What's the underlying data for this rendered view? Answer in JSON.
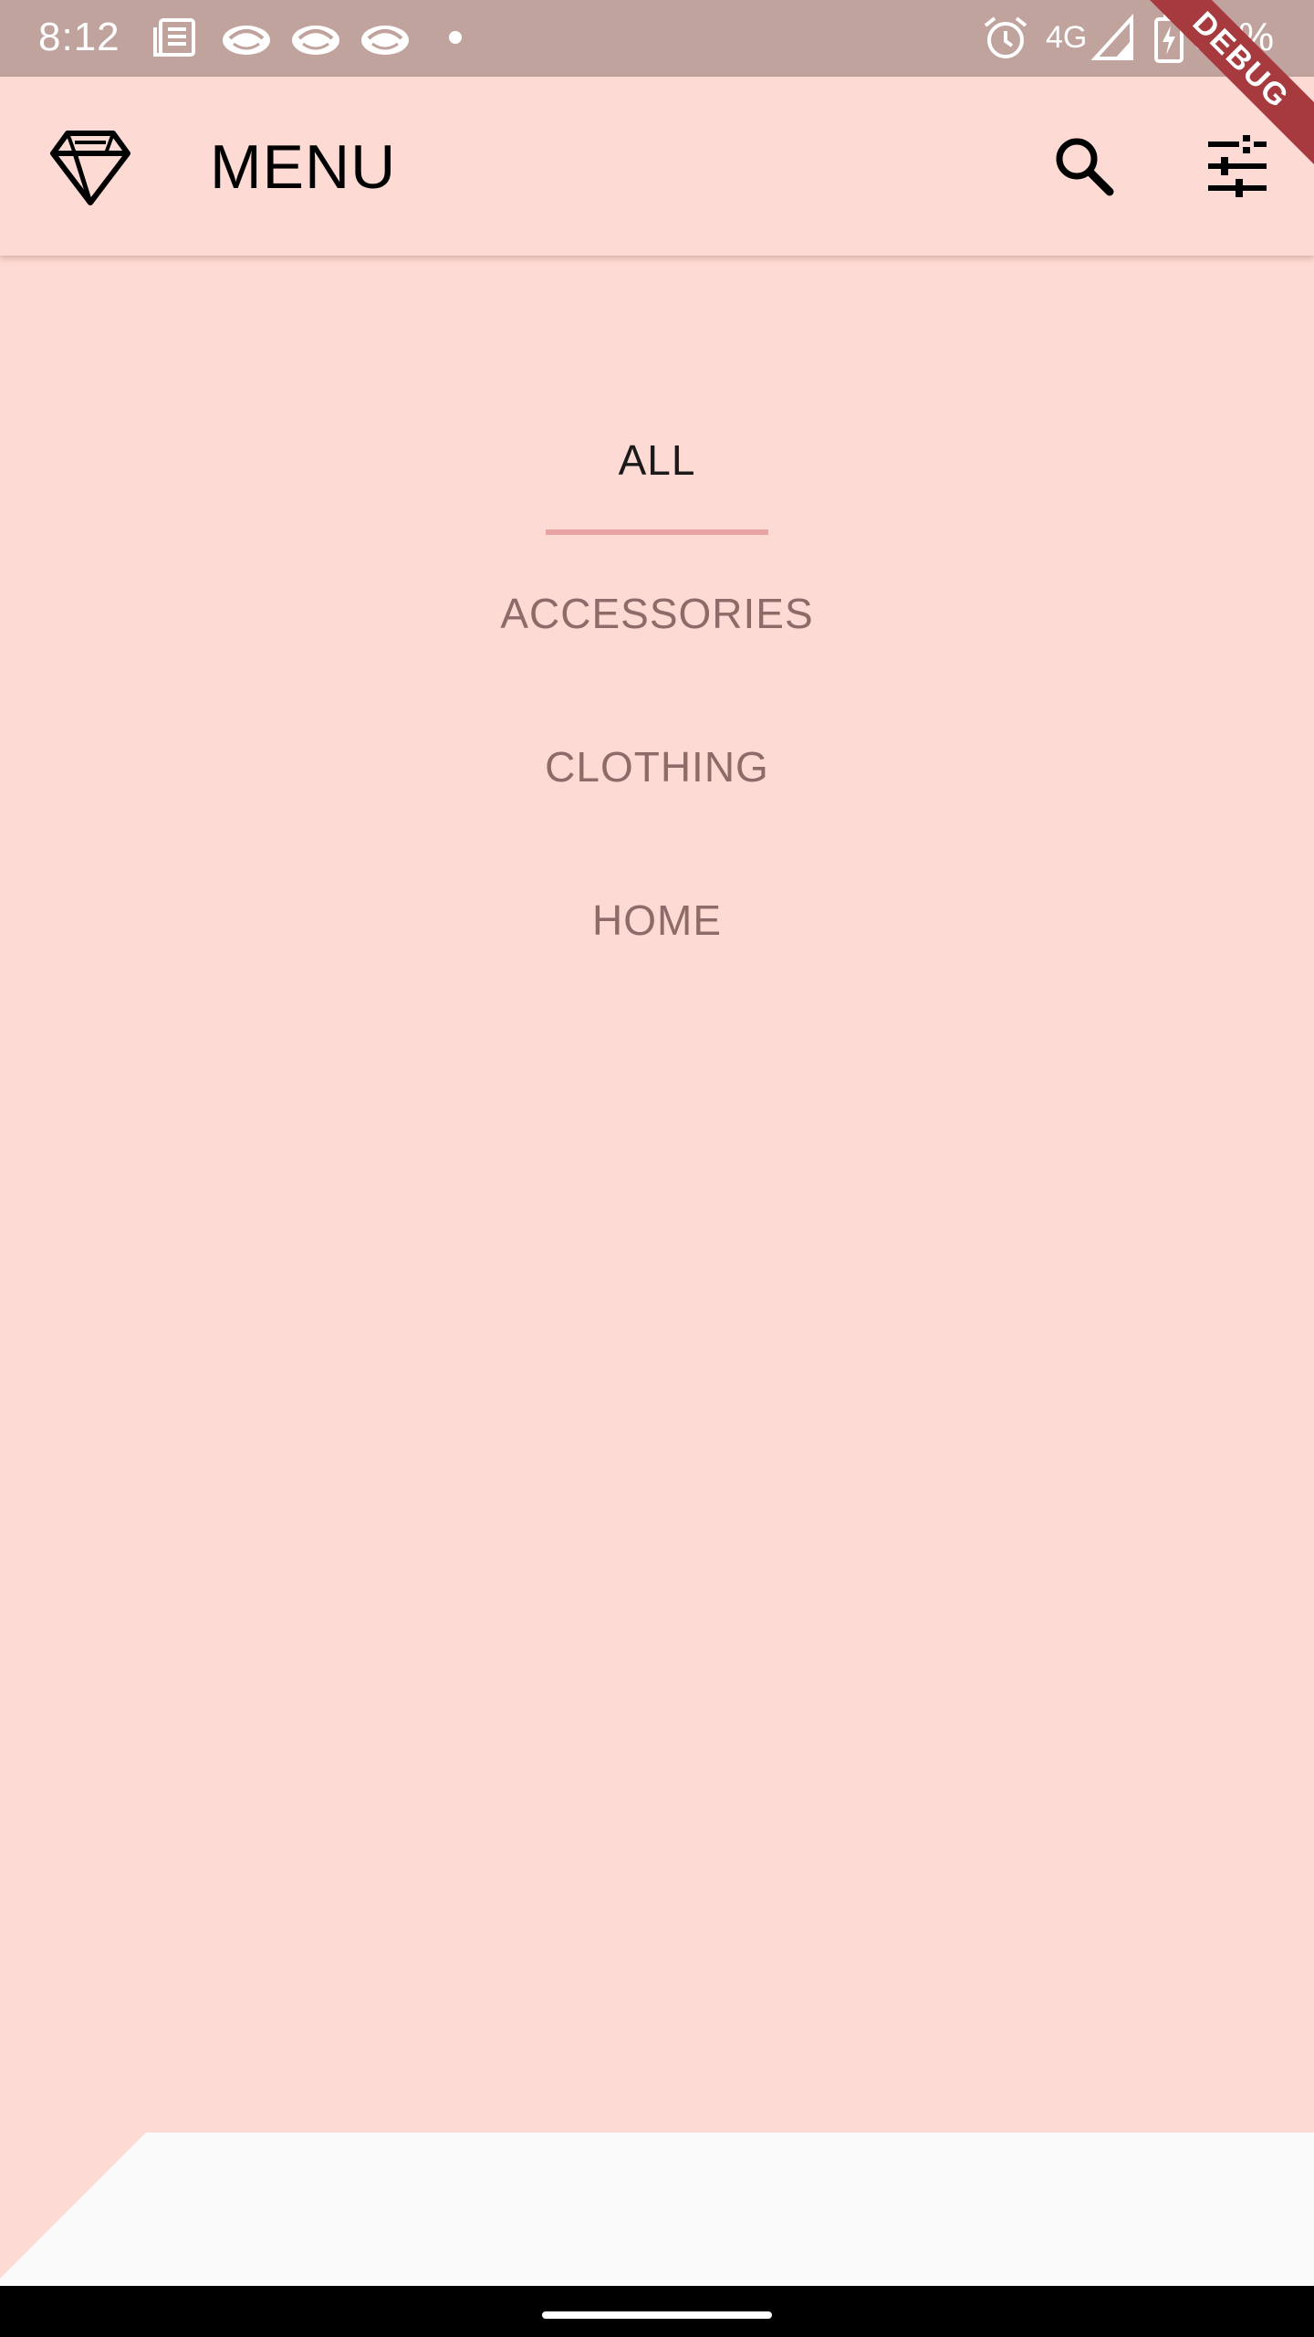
{
  "status_bar": {
    "time": "8:12",
    "network": "4G",
    "battery": "51%",
    "icons": [
      "news-icon",
      "mail-icon",
      "mail-icon",
      "mail-icon",
      "dot-icon",
      "alarm-icon",
      "signal-icon",
      "battery-charging-icon"
    ]
  },
  "debug_banner": "DEBUG",
  "app_bar": {
    "title": "MENU",
    "logo_icon": "diamond-icon",
    "actions": [
      "search-icon",
      "tune-icon"
    ]
  },
  "menu": {
    "items": [
      {
        "label": "ALL",
        "active": true
      },
      {
        "label": "ACCESSORIES",
        "active": false
      },
      {
        "label": "CLOTHING",
        "active": false
      },
      {
        "label": "HOME",
        "active": false
      }
    ]
  },
  "colors": {
    "background": "#FDDAD3",
    "status_bar": "#C1A39E",
    "inactive_text": "#8E6A69",
    "underline": "#E8A3A3",
    "debug_banner": "#A63A3E"
  }
}
